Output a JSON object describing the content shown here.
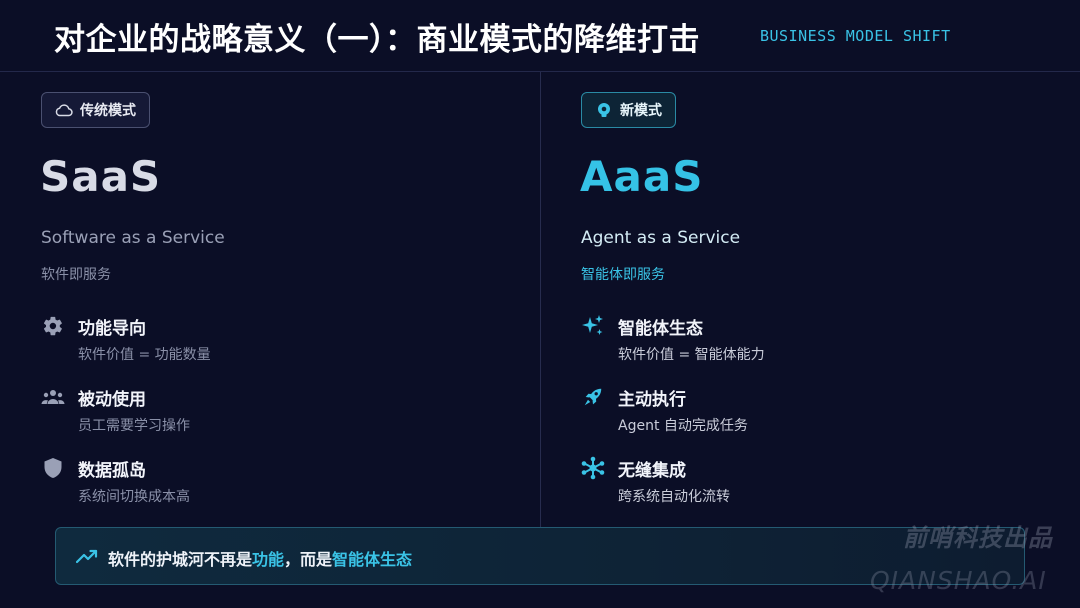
{
  "header": {
    "title": "对企业的战略意义（一）：商业模式的降维打击",
    "subtitle_en": "BUSINESS MODEL SHIFT"
  },
  "left": {
    "tag": "传统模式",
    "tag_icon": "cloud-icon",
    "name": "SaaS",
    "name_en": "Software as a Service",
    "name_cn": "软件即服务",
    "features": [
      {
        "icon": "gear-icon",
        "title": "功能导向",
        "desc": "软件价值 = 功能数量"
      },
      {
        "icon": "users-icon",
        "title": "被动使用",
        "desc": "员工需要学习操作"
      },
      {
        "icon": "shield-icon",
        "title": "数据孤岛",
        "desc": "系统间切换成本高"
      }
    ]
  },
  "right": {
    "tag": "新模式",
    "tag_icon": "brain-icon",
    "name": "AaaS",
    "name_en": "Agent as a Service",
    "name_cn": "智能体即服务",
    "features": [
      {
        "icon": "sparkles-icon",
        "title": "智能体生态",
        "desc": "软件价值 = 智能体能力"
      },
      {
        "icon": "rocket-icon",
        "title": "主动执行",
        "desc": "Agent 自动完成任务"
      },
      {
        "icon": "network-icon",
        "title": "无缝集成",
        "desc": "跨系统自动化流转"
      }
    ]
  },
  "bottom": {
    "icon": "trend-up-icon",
    "text_a": "软件的护城河不再是",
    "text_hl1": "功能",
    "text_b": "，而是",
    "text_hl2": "智能体生态"
  },
  "watermark": {
    "line1": "前哨科技出品",
    "line2": "QIANSHAO.AI"
  },
  "colors": {
    "background": "#0b0e26",
    "accent": "#3ac3e6",
    "muted": "#8a90a8"
  }
}
